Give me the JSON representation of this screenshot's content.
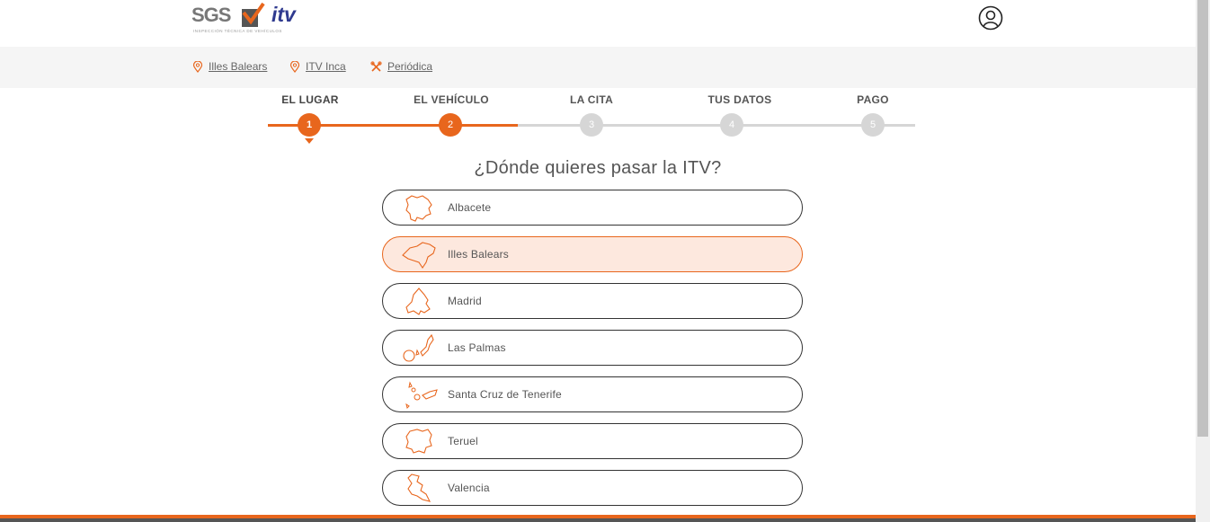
{
  "header": {
    "logo_sgs": "SGS",
    "logo_itv": "itv",
    "logo_tagline": "INSPECCIÓN TÉCNICA DE VEHÍCULOS"
  },
  "breadcrumbs": [
    {
      "icon": "location-pin-icon",
      "label": "Illes Balears"
    },
    {
      "icon": "location-pin-icon",
      "label": "ITV Inca"
    },
    {
      "icon": "tools-icon",
      "label": "Periódica"
    }
  ],
  "steps": [
    {
      "label": "EL LUGAR",
      "number": "1",
      "state": "current"
    },
    {
      "label": "EL VEHÍCULO",
      "number": "2",
      "state": "done"
    },
    {
      "label": "LA CITA",
      "number": "3",
      "state": "pending"
    },
    {
      "label": "TUS DATOS",
      "number": "4",
      "state": "pending"
    },
    {
      "label": "PAGO",
      "number": "5",
      "state": "pending"
    }
  ],
  "question": "¿Dónde quieres pasar la ITV?",
  "options": [
    {
      "label": "Albacete",
      "icon": "albacete-map-icon",
      "selected": false
    },
    {
      "label": "Illes Balears",
      "icon": "balearic-islands-map-icon",
      "selected": true
    },
    {
      "label": "Madrid",
      "icon": "madrid-map-icon",
      "selected": false
    },
    {
      "label": "Las Palmas",
      "icon": "las-palmas-map-icon",
      "selected": false
    },
    {
      "label": "Santa Cruz de Tenerife",
      "icon": "tenerife-map-icon",
      "selected": false
    },
    {
      "label": "Teruel",
      "icon": "teruel-map-icon",
      "selected": false
    },
    {
      "label": "Valencia",
      "icon": "valencia-map-icon",
      "selected": false
    }
  ],
  "colors": {
    "accent": "#e8661d",
    "pending": "#d6d6d6",
    "selected_bg": "#fde8de",
    "brand_blue": "#2f3a8f"
  }
}
